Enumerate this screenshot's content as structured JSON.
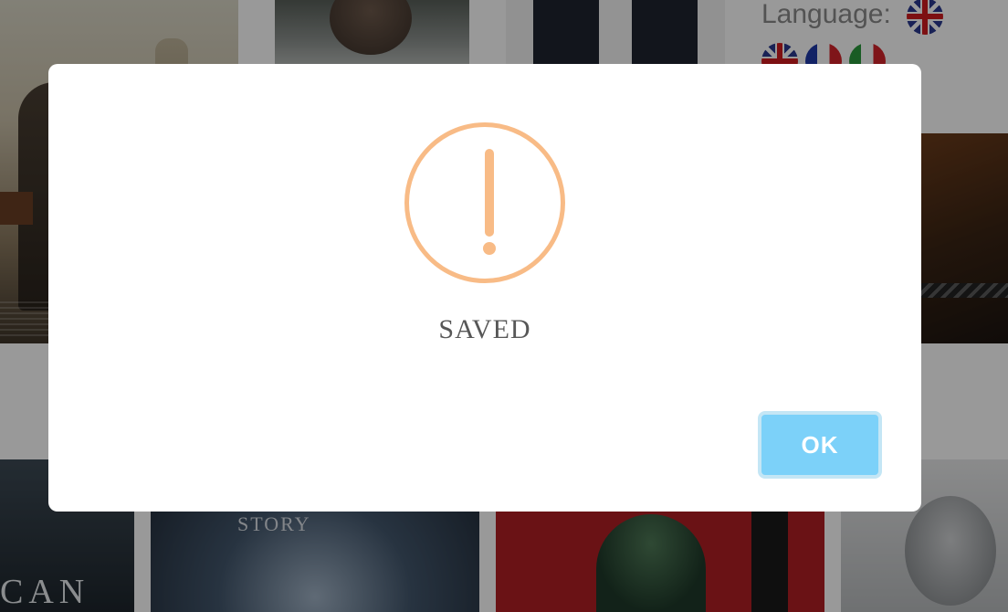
{
  "header": {
    "language_label": "Language:",
    "current_language_icon": "uk-flag-icon",
    "language_options": [
      {
        "icon": "uk-flag-icon"
      },
      {
        "icon": "france-flag-icon"
      },
      {
        "icon": "italy-flag-icon"
      }
    ]
  },
  "posters": [
    {
      "name": "poster-1"
    },
    {
      "name": "poster-2"
    },
    {
      "name": "poster-3"
    },
    {
      "name": "poster-4"
    },
    {
      "name": "poster-5",
      "visible_text": "CAN"
    },
    {
      "name": "poster-6",
      "visible_text": "STORY"
    },
    {
      "name": "poster-7"
    },
    {
      "name": "poster-8"
    }
  ],
  "dialog": {
    "icon": "warning-icon",
    "title": "SAVED",
    "ok_label": "OK",
    "colors": {
      "icon": "#f8bb86",
      "button": "#7cd1f9",
      "button_border": "#c4e6f5",
      "title": "#575757"
    }
  }
}
